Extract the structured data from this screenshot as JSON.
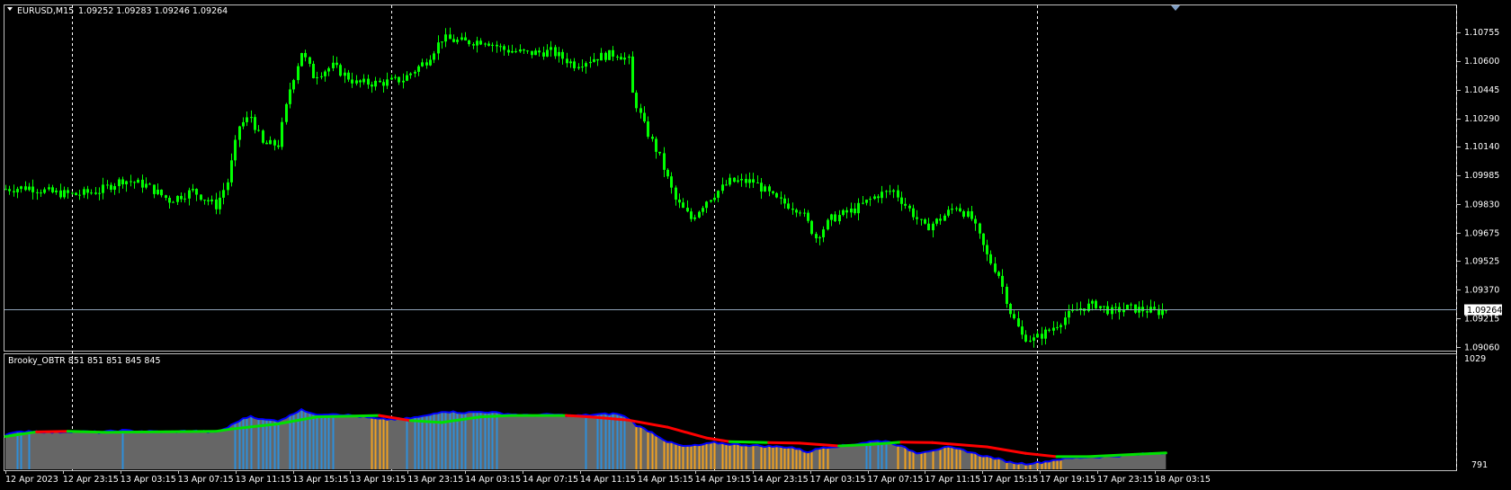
{
  "colors": {
    "background": "#000000",
    "frame": "#c0c0c0",
    "grid": "#ffffff",
    "candle": "#00ff00",
    "current_price_line": "#8fa3b8",
    "ind_fill": "#666666",
    "ind_bull": "#2e8fd9",
    "ind_bear": "#f0a020",
    "ind_envelope": "#0000ff",
    "ind_up": "#00e000",
    "ind_down": "#ff0000"
  },
  "header": {
    "symbol_label": "EURUSD,M15",
    "ohlc_label": "1.09252 1.09283 1.09246 1.09264"
  },
  "indicator": {
    "label": "Brooky_OBTR 851 851 851 845 845",
    "top_label": "1029",
    "bottom_label": "791"
  },
  "current_price_tag": "1.09264",
  "chart_data": {
    "type": "candlestick",
    "symbol": "EURUSD",
    "timeframe": "M15",
    "ylim": [
      1.0906,
      1.1083
    ],
    "y_ticks": [
      "1.10755",
      "1.10600",
      "1.10445",
      "1.10290",
      "1.10140",
      "1.09985",
      "1.09830",
      "1.09675",
      "1.09525",
      "1.09370",
      "1.09215",
      "1.09060"
    ],
    "current_price": 1.09264,
    "x_ticks": [
      "12 Apr 2023",
      "12 Apr 23:15",
      "13 Apr 03:15",
      "13 Apr 07:15",
      "13 Apr 11:15",
      "13 Apr 15:15",
      "13 Apr 19:15",
      "13 Apr 23:15",
      "14 Apr 03:15",
      "14 Apr 07:15",
      "14 Apr 11:15",
      "14 Apr 15:15",
      "14 Apr 19:15",
      "14 Apr 23:15",
      "17 Apr 03:15",
      "17 Apr 07:15",
      "17 Apr 11:15",
      "17 Apr 15:15",
      "17 Apr 19:15",
      "17 Apr 23:15",
      "18 Apr 03:15"
    ],
    "close_path": [
      [
        0,
        1.0991
      ],
      [
        6,
        1.0992
      ],
      [
        12,
        1.0989
      ],
      [
        18,
        1.0988
      ],
      [
        24,
        1.099
      ],
      [
        30,
        1.0996
      ],
      [
        36,
        1.0993
      ],
      [
        42,
        1.0985
      ],
      [
        48,
        1.099
      ],
      [
        54,
        1.0982
      ],
      [
        57,
        1.0995
      ],
      [
        60,
        1.1025
      ],
      [
        63,
        1.103
      ],
      [
        66,
        1.1015
      ],
      [
        70,
        1.1015
      ],
      [
        73,
        1.1045
      ],
      [
        76,
        1.1065
      ],
      [
        79,
        1.1052
      ],
      [
        84,
        1.1057
      ],
      [
        90,
        1.1048
      ],
      [
        96,
        1.1048
      ],
      [
        102,
        1.105
      ],
      [
        108,
        1.106
      ],
      [
        112,
        1.1072
      ],
      [
        118,
        1.107
      ],
      [
        123,
        1.1071
      ],
      [
        128,
        1.1066
      ],
      [
        134,
        1.1064
      ],
      [
        140,
        1.1065
      ],
      [
        146,
        1.1058
      ],
      [
        152,
        1.1062
      ],
      [
        157,
        1.1064
      ],
      [
        160,
        1.106
      ],
      [
        161,
        1.1042
      ],
      [
        164,
        1.1025
      ],
      [
        168,
        1.1008
      ],
      [
        172,
        1.0985
      ],
      [
        176,
        1.0975
      ],
      [
        180,
        1.0985
      ],
      [
        186,
        1.0995
      ],
      [
        192,
        1.0995
      ],
      [
        198,
        1.0985
      ],
      [
        204,
        1.098
      ],
      [
        208,
        1.0965
      ],
      [
        212,
        1.0975
      ],
      [
        218,
        1.098
      ],
      [
        224,
        1.0988
      ],
      [
        228,
        1.099
      ],
      [
        232,
        1.098
      ],
      [
        236,
        1.097
      ],
      [
        240,
        1.0975
      ],
      [
        244,
        1.0982
      ],
      [
        248,
        1.0975
      ],
      [
        252,
        1.0955
      ],
      [
        255,
        1.0945
      ],
      [
        258,
        1.0925
      ],
      [
        261,
        1.0912
      ],
      [
        264,
        1.091
      ],
      [
        268,
        1.0915
      ],
      [
        272,
        1.0922
      ],
      [
        276,
        1.0927
      ],
      [
        280,
        1.0929
      ],
      [
        284,
        1.0925
      ],
      [
        288,
        1.0927
      ],
      [
        292,
        1.0926
      ],
      [
        296,
        1.0925
      ],
      [
        298,
        1.09264
      ]
    ],
    "indicator_series": {
      "name": "Brooky_OBTR",
      "ylim": [
        791,
        1029
      ],
      "values": [
        [
          0,
          866
        ],
        [
          6,
          873
        ],
        [
          12,
          870
        ],
        [
          18,
          872
        ],
        [
          24,
          870
        ],
        [
          30,
          874
        ],
        [
          36,
          872
        ],
        [
          42,
          871
        ],
        [
          48,
          873
        ],
        [
          54,
          870
        ],
        [
          57,
          880
        ],
        [
          60,
          895
        ],
        [
          63,
          905
        ],
        [
          66,
          897
        ],
        [
          70,
          895
        ],
        [
          73,
          905
        ],
        [
          76,
          920
        ],
        [
          79,
          908
        ],
        [
          84,
          910
        ],
        [
          90,
          905
        ],
        [
          96,
          898
        ],
        [
          102,
          898
        ],
        [
          108,
          905
        ],
        [
          112,
          915
        ],
        [
          118,
          912
        ],
        [
          123,
          914
        ],
        [
          128,
          910
        ],
        [
          134,
          906
        ],
        [
          140,
          908
        ],
        [
          146,
          905
        ],
        [
          152,
          908
        ],
        [
          157,
          910
        ],
        [
          160,
          900
        ],
        [
          162,
          885
        ],
        [
          166,
          870
        ],
        [
          170,
          850
        ],
        [
          174,
          840
        ],
        [
          178,
          842
        ],
        [
          182,
          848
        ],
        [
          186,
          845
        ],
        [
          190,
          843
        ],
        [
          196,
          840
        ],
        [
          202,
          838
        ],
        [
          206,
          828
        ],
        [
          210,
          838
        ],
        [
          216,
          842
        ],
        [
          222,
          850
        ],
        [
          226,
          852
        ],
        [
          230,
          840
        ],
        [
          234,
          826
        ],
        [
          238,
          832
        ],
        [
          242,
          838
        ],
        [
          246,
          832
        ],
        [
          250,
          822
        ],
        [
          254,
          815
        ],
        [
          258,
          806
        ],
        [
          262,
          803
        ],
        [
          266,
          806
        ],
        [
          270,
          812
        ],
        [
          274,
          815
        ],
        [
          278,
          817
        ],
        [
          282,
          818
        ],
        [
          286,
          820
        ],
        [
          290,
          822
        ],
        [
          294,
          825
        ],
        [
          298,
          826
        ]
      ],
      "ma_up_down": [
        [
          0,
          861,
          "up"
        ],
        [
          8,
          871,
          "up"
        ],
        [
          16,
          872,
          "down"
        ],
        [
          26,
          870,
          "up"
        ],
        [
          54,
          872,
          "up"
        ],
        [
          58,
          877,
          "up"
        ],
        [
          70,
          888,
          "up"
        ],
        [
          80,
          903,
          "up"
        ],
        [
          96,
          906,
          "up"
        ],
        [
          104,
          895,
          "down"
        ],
        [
          112,
          891,
          "up"
        ],
        [
          122,
          903,
          "up"
        ],
        [
          130,
          906,
          "up"
        ],
        [
          144,
          906,
          "up"
        ],
        [
          150,
          903,
          "down"
        ],
        [
          160,
          896,
          "down"
        ],
        [
          170,
          881,
          "down"
        ],
        [
          180,
          858,
          "down"
        ],
        [
          186,
          850,
          "down"
        ],
        [
          196,
          848,
          "up"
        ],
        [
          204,
          847,
          "down"
        ],
        [
          214,
          841,
          "down"
        ],
        [
          222,
          844,
          "up"
        ],
        [
          230,
          849,
          "up"
        ],
        [
          238,
          848,
          "down"
        ],
        [
          252,
          839,
          "down"
        ],
        [
          262,
          825,
          "down"
        ],
        [
          270,
          818,
          "down"
        ],
        [
          278,
          818,
          "up"
        ],
        [
          290,
          823,
          "up"
        ],
        [
          298,
          826,
          "up"
        ]
      ]
    }
  }
}
